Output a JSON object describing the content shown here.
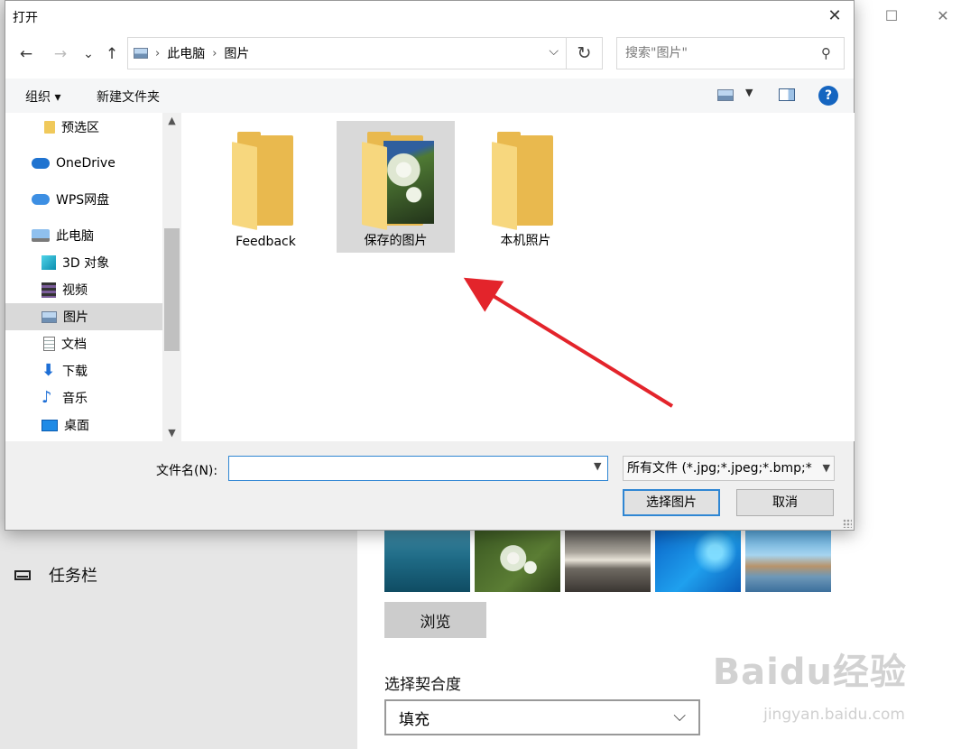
{
  "background_window": {
    "controls": {
      "maximize": "☐",
      "close": "✕"
    },
    "taskbar_label": "任务栏",
    "browse_button": "浏览",
    "fit_label": "选择契合度",
    "fit_value": "填充",
    "watermark": "Baidu经验",
    "watermark_url": "jingyan.baidu.com"
  },
  "dialog": {
    "title": "打开",
    "nav": {
      "back": "←",
      "forward": "→",
      "recent": "⌄",
      "up": "↑"
    },
    "address": {
      "crumbs": [
        "此电脑",
        "图片"
      ],
      "separator": "›"
    },
    "search_placeholder": "搜索\"图片\"",
    "toolbar": {
      "organize": "组织 ▾",
      "new_folder": "新建文件夹",
      "help": "?"
    },
    "sidebar": [
      {
        "label": "预选区",
        "icon": "folder-icon"
      },
      {
        "label": "OneDrive",
        "icon": "onedrive-icon"
      },
      {
        "label": "WPS网盘",
        "icon": "cloud-icon"
      },
      {
        "label": "此电脑",
        "icon": "computer-icon"
      },
      {
        "label": "3D 对象",
        "icon": "cube-icon"
      },
      {
        "label": "视频",
        "icon": "video-icon"
      },
      {
        "label": "图片",
        "icon": "picture-icon",
        "selected": true
      },
      {
        "label": "文档",
        "icon": "document-icon"
      },
      {
        "label": "下载",
        "icon": "download-icon"
      },
      {
        "label": "音乐",
        "icon": "music-icon"
      },
      {
        "label": "桌面",
        "icon": "desktop-icon"
      }
    ],
    "folders": [
      {
        "label": "Feedback"
      },
      {
        "label": "保存的图片",
        "selected": true
      },
      {
        "label": "本机照片"
      }
    ],
    "filename_label": "文件名(N):",
    "filename_value": "",
    "filetype_value": "所有文件 (*.jpg;*.jpeg;*.bmp;*",
    "open_button": "选择图片",
    "cancel_button": "取消"
  },
  "colors": {
    "accent": "#2f86d3",
    "arrow": "#e3242b",
    "selection": "#d9d9d9"
  }
}
